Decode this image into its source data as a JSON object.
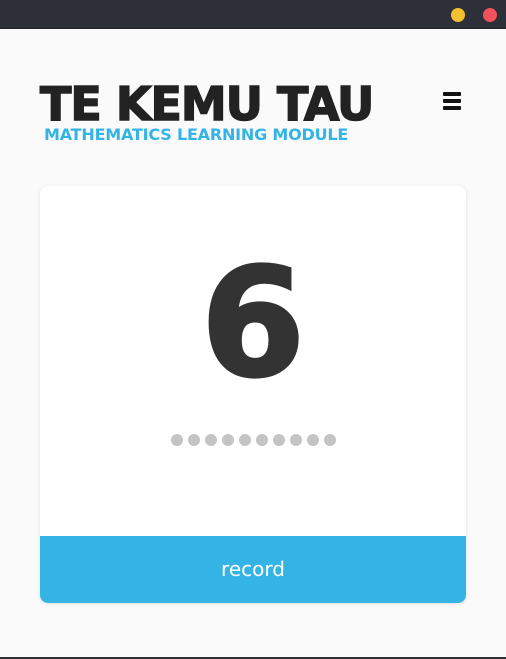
{
  "window": {
    "buttons": [
      {
        "name": "minimize",
        "color": "#f5c02f"
      },
      {
        "name": "close",
        "color": "#f0515a"
      }
    ]
  },
  "header": {
    "title": "TE KEMU TAU",
    "subtitle": "MATHEMATICS LEARNING MODULE",
    "menu_icon": "hamburger-menu-icon"
  },
  "card": {
    "number": "6",
    "progress": {
      "total": 10,
      "completed": 0
    },
    "record_label": "record"
  },
  "colors": {
    "accent": "#33b4e5",
    "title": "#222222",
    "number": "#333333",
    "dot": "#c4c4c4",
    "titlebar": "#2d3039",
    "background": "#fafafa"
  }
}
